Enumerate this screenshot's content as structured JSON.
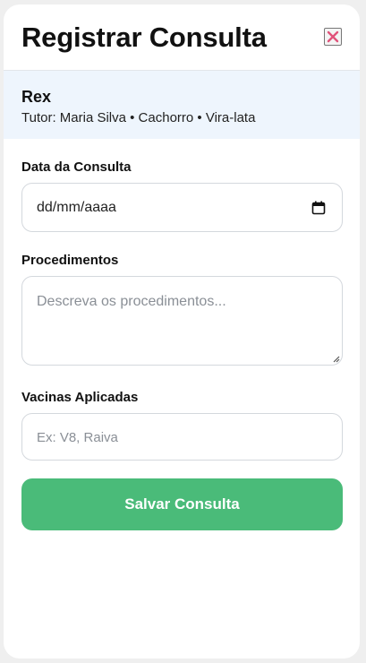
{
  "modal": {
    "title": "Registrar Consulta",
    "close_icon": "close-icon"
  },
  "pet": {
    "name": "Rex",
    "details": "Tutor: Maria Silva • Cachorro • Vira-lata"
  },
  "form": {
    "date": {
      "label": "Data da Consulta",
      "value": "dd/mm/aaaa",
      "icon": "calendar-icon"
    },
    "procedures": {
      "label": "Procedimentos",
      "placeholder": "Descreva os procedimentos..."
    },
    "vaccines": {
      "label": "Vacinas Aplicadas",
      "placeholder": "Ex: V8, Raiva"
    },
    "submit_label": "Salvar Consulta"
  },
  "colors": {
    "accent_green": "#4abb79",
    "info_background": "#eef5fd",
    "close_icon": "#e0527a"
  }
}
